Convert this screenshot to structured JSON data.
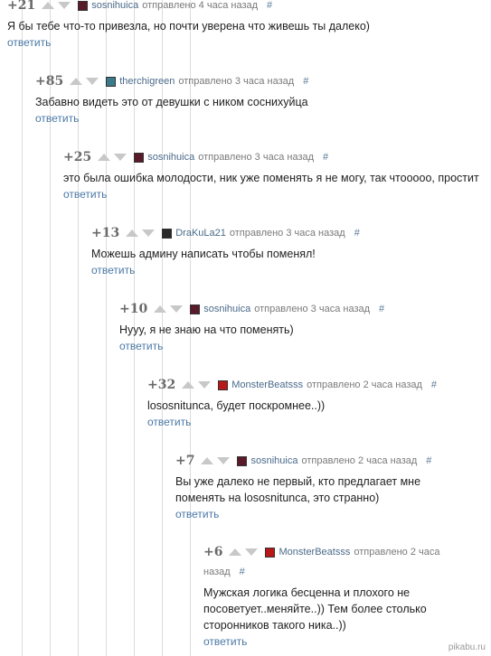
{
  "comments": [
    {
      "rating": "+21",
      "author": "sosnihuica",
      "sent": "отправлено 4 часа назад",
      "hash": "#",
      "text": "Я бы тебе что-то привезла, но почти уверена что живешь ты далеко)",
      "reply": "ответить",
      "avatar_color": "#5a1a2a"
    },
    {
      "rating": "+85",
      "author": "therchigreen",
      "sent": "отправлено 3 часа назад",
      "hash": "#",
      "text": "Забавно видеть это от девушки с ником соснихуйца",
      "reply": "ответить",
      "avatar_color": "#3a7a8a"
    },
    {
      "rating": "+25",
      "author": "sosnihuica",
      "sent": "отправлено 3 часа назад",
      "hash": "#",
      "text": "это была ошибка молодости, ник уже поменять я не могу, так чтооооо, простит",
      "reply": "ответить",
      "avatar_color": "#5a1a2a"
    },
    {
      "rating": "+13",
      "author": "DraKuLa21",
      "sent": "отправлено 3 часа назад",
      "hash": "#",
      "text": "Можешь админу написать чтобы поменял!",
      "reply": "ответить",
      "avatar_color": "#2a2a2a"
    },
    {
      "rating": "+10",
      "author": "sosnihuica",
      "sent": "отправлено 3 часа назад",
      "hash": "#",
      "text": "Нууу, я не знаю на что поменять)",
      "reply": "ответить",
      "avatar_color": "#5a1a2a"
    },
    {
      "rating": "+32",
      "author": "MonsterBeatsss",
      "sent": "отправлено 2 часа назад",
      "hash": "#",
      "text": "lososnitunca, будет поскромнее..))",
      "reply": "ответить",
      "avatar_color": "#b81818"
    },
    {
      "rating": "+7",
      "author": "sosnihuica",
      "sent": "отправлено 2 часа назад",
      "hash": "#",
      "text": "Вы уже далеко не первый, кто предлагает мне\nпоменять на lososnitunca, это странно)",
      "reply": "ответить",
      "avatar_color": "#5a1a2a"
    },
    {
      "rating": "+6",
      "author": "MonsterBeatsss",
      "sent": "отправлено 2 часа",
      "sent2": "назад",
      "hash": "#",
      "text": "Мужская логика бесценна и плохого не\nпосоветует..меняйте..)) Тем более столько\nсторонников такого ника..))",
      "reply": "ответить",
      "avatar_color": "#b81818"
    }
  ],
  "watermark": "pikabu.ru"
}
